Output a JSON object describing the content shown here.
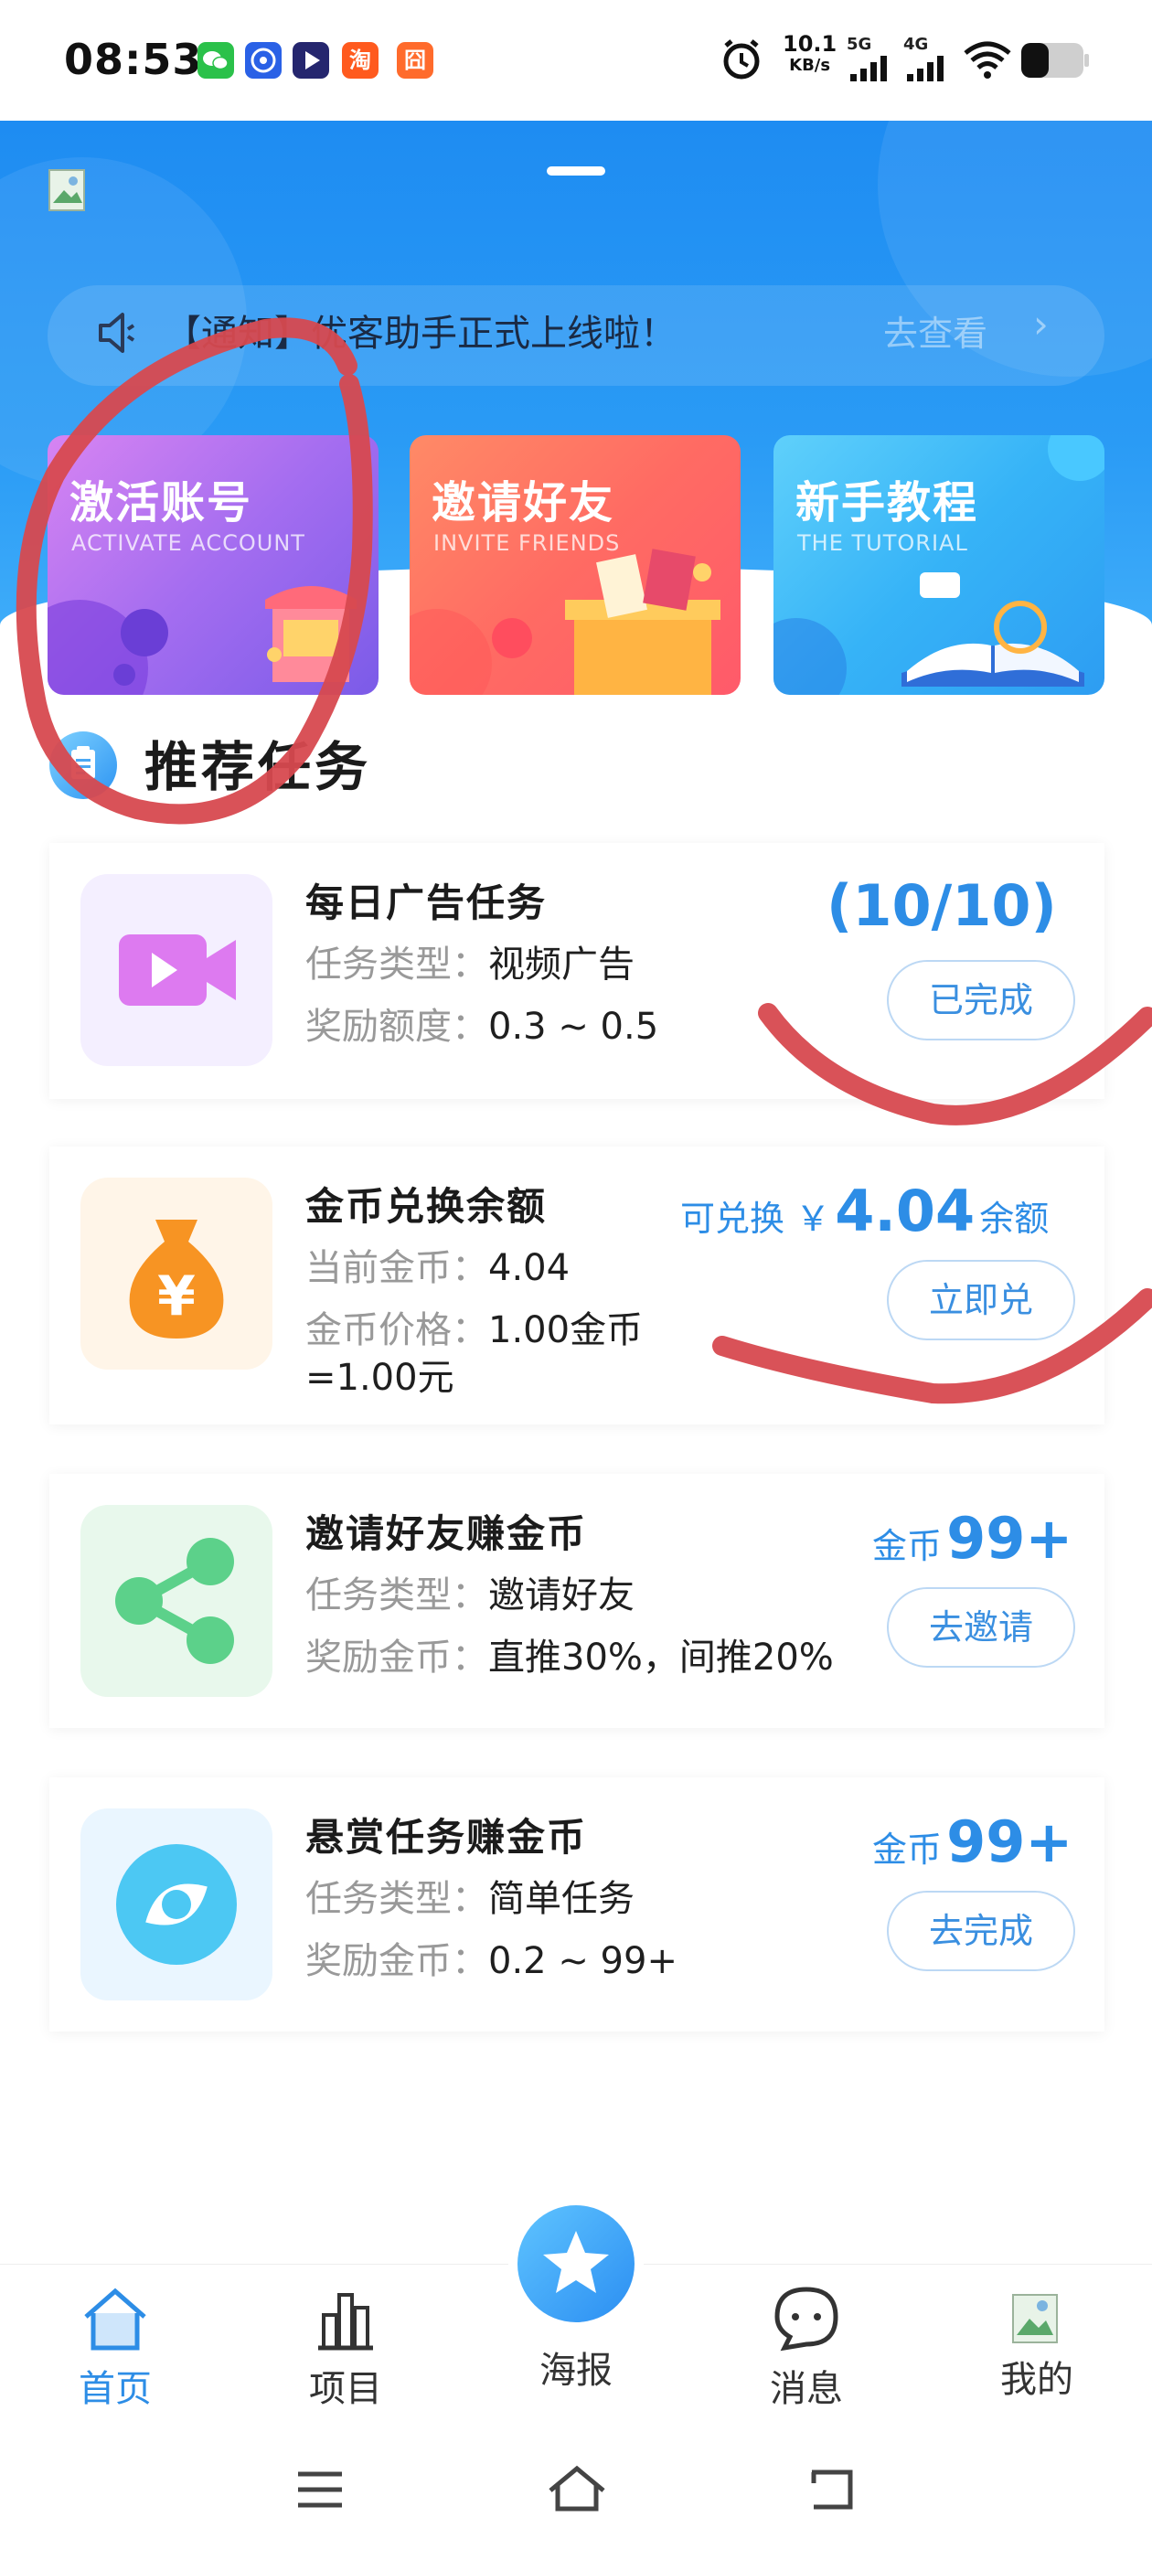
{
  "status_bar": {
    "time": "08:53",
    "speed_value": "10.1",
    "speed_unit": "KB/s",
    "signal_1": "5G",
    "signal_2": "4G",
    "app_icons": [
      "wechat-icon",
      "baidu-icon",
      "video-icon",
      "taobao-icon",
      "gallery-icon"
    ],
    "app_icon_glyphs": [
      "",
      "",
      "",
      "淘",
      "囧"
    ]
  },
  "notice": {
    "text": "【通知】优客助手正式上线啦！",
    "link": "去查看",
    "arrow": "›"
  },
  "banners": [
    {
      "title": "激活账号",
      "subtitle": "ACTIVATE ACCOUNT"
    },
    {
      "title": "邀请好友",
      "subtitle": "INVITE FRIENDS"
    },
    {
      "title": "新手教程",
      "subtitle": "THE TUTORIAL"
    }
  ],
  "section": {
    "title": "推荐任务"
  },
  "tasks": [
    {
      "title": "每日广告任务",
      "row1_label": "任务类型：",
      "row1_value": "视频广告",
      "row2_label": "奖励额度：",
      "row2_value": "0.3 ~ 0.5",
      "progress": "(10/10)",
      "button": "已完成"
    },
    {
      "title": "金币兑换余额",
      "row1_label": "当前金币：",
      "row1_value": "4.04",
      "row2_label": "金币价格：",
      "row2_value": "1.00金币",
      "row2_value_cont": "=1.00元",
      "prefix": "可兑换 ￥",
      "amount": "4.04",
      "suffix": "余额",
      "button": "立即兑"
    },
    {
      "title": "邀请好友赚金币",
      "row1_label": "任务类型：",
      "row1_value": "邀请好友",
      "row2_label": "奖励金币：",
      "row2_value": "直推30%，间推20%",
      "prefix": "金币",
      "amount": "99+",
      "button": "去邀请"
    },
    {
      "title": "悬赏任务赚金币",
      "row1_label": "任务类型：",
      "row1_value": "简单任务",
      "row2_label": "奖励金币：",
      "row2_value": "0.2 ~ 99+",
      "prefix": "金币",
      "amount": "99+",
      "button": "去完成"
    }
  ],
  "nav": {
    "items": [
      {
        "label": "首页",
        "icon": "home-icon"
      },
      {
        "label": "项目",
        "icon": "project-icon"
      },
      {
        "label": "海报",
        "icon": "star-icon"
      },
      {
        "label": "消息",
        "icon": "message-icon"
      },
      {
        "label": "我的",
        "icon": "profile-image-icon"
      }
    ]
  },
  "colors": {
    "accent": "#2d8de6",
    "hero": "#1e8cf2",
    "annotation": "#d7494f"
  }
}
